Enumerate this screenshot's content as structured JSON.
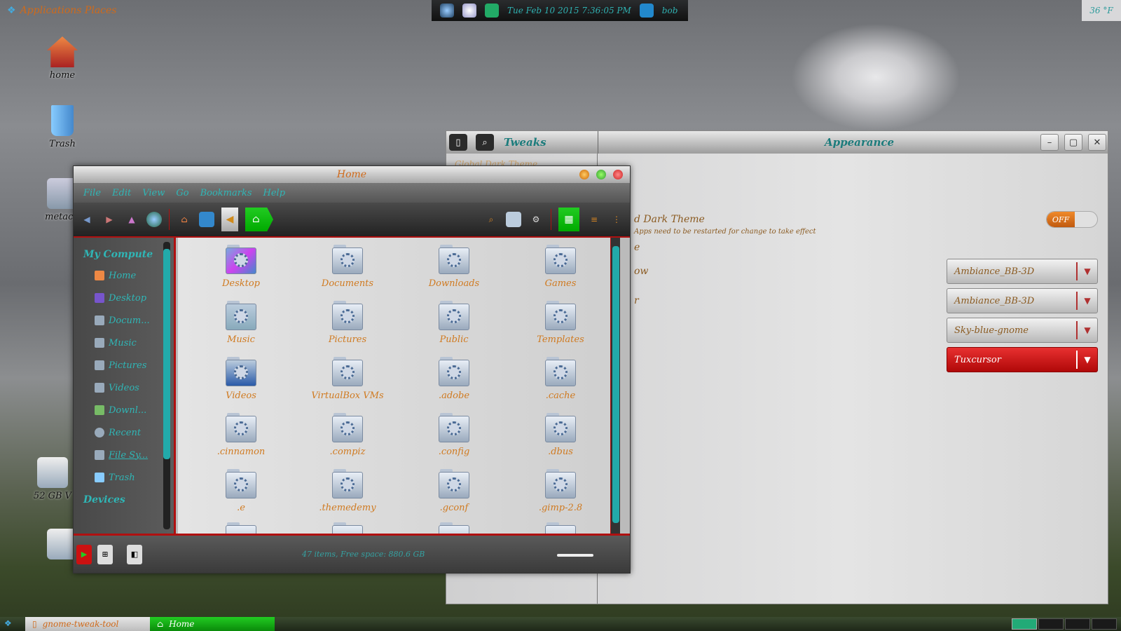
{
  "top_panel": {
    "left_label": "Applications Places",
    "center_datetime": "Tue Feb 10 2015 7:36:05 PM",
    "center_user": "bob",
    "right_temp": "36 °F"
  },
  "desktop_icons": [
    {
      "label": "home"
    },
    {
      "label": "Trash"
    },
    {
      "label": "metacit"
    },
    {
      "label": "52 GB V"
    }
  ],
  "tweak_window": {
    "title_left": "Tweaks",
    "title_center": "Appearance",
    "left_item": "Global Dark Theme",
    "dark_theme_label": "d Dark Theme",
    "dark_theme_sub": "Apps need to be restarted for change to take effect",
    "toggle_value": "OFF",
    "partial_rows": [
      "e",
      "ow",
      "r"
    ],
    "combos": [
      "Ambiance_BB-3D",
      "Ambiance_BB-3D",
      "Sky-blue-gnome",
      "Tuxcursor"
    ]
  },
  "nautilus": {
    "title": "Home",
    "menu": [
      "File",
      "Edit",
      "View",
      "Go",
      "Bookmarks",
      "Help"
    ],
    "sidebar_head": "My Compute",
    "sidebar_items": [
      "Home",
      "Desktop",
      "Docum...",
      "Music",
      "Pictures",
      "Videos",
      "Downl...",
      "Recent",
      "File Sy...",
      "Trash"
    ],
    "devices_head": "Devices",
    "files": [
      "Desktop",
      "Documents",
      "Downloads",
      "Games",
      "Music",
      "Pictures",
      "Public",
      "Templates",
      "Videos",
      "VirtualBox VMs",
      ".adobe",
      ".cache",
      ".cinnamon",
      ".compiz",
      ".config",
      ".dbus",
      ".e",
      ".themedemy",
      ".gconf",
      ".gimp-2.8"
    ],
    "status": "47 items, Free space: 880.6 GB"
  },
  "taskbar": {
    "tasks": [
      "gnome-tweak-tool",
      "Home"
    ]
  }
}
